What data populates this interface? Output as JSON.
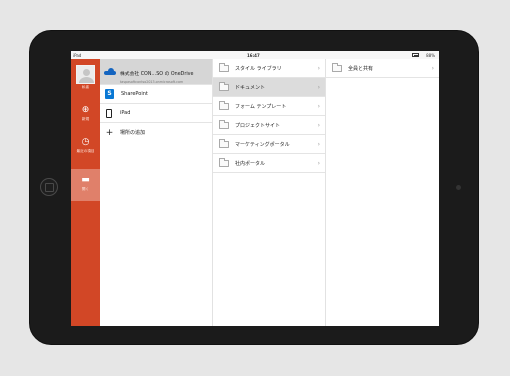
{
  "status": {
    "carrier": "iPad",
    "time": "16:47",
    "battery": "88%"
  },
  "rail": {
    "items": [
      {
        "label": "私者",
        "icon": "avatar"
      },
      {
        "label": "新規",
        "icon": "new-icon"
      },
      {
        "label": "最近の項目",
        "icon": "clock-icon"
      },
      {
        "label": "開く",
        "icon": "folder-icon"
      }
    ]
  },
  "locations": {
    "onedrive": {
      "title": "株式会社 CON…SO の OneDrive",
      "subtitle": "taspasoftcontso2013.onmicrosoft.com"
    },
    "sharepoint": "SharePoint",
    "ipad": "iPad",
    "add_place": "場所の追加"
  },
  "sites": [
    "スタイル ライブラリ",
    "ドキュメント",
    "フォーム テンプレート",
    "プロジェクトサイト",
    "マーケティングポータル",
    "社内ポータル"
  ],
  "documents": [
    "全員と共有"
  ],
  "chevron": "›"
}
